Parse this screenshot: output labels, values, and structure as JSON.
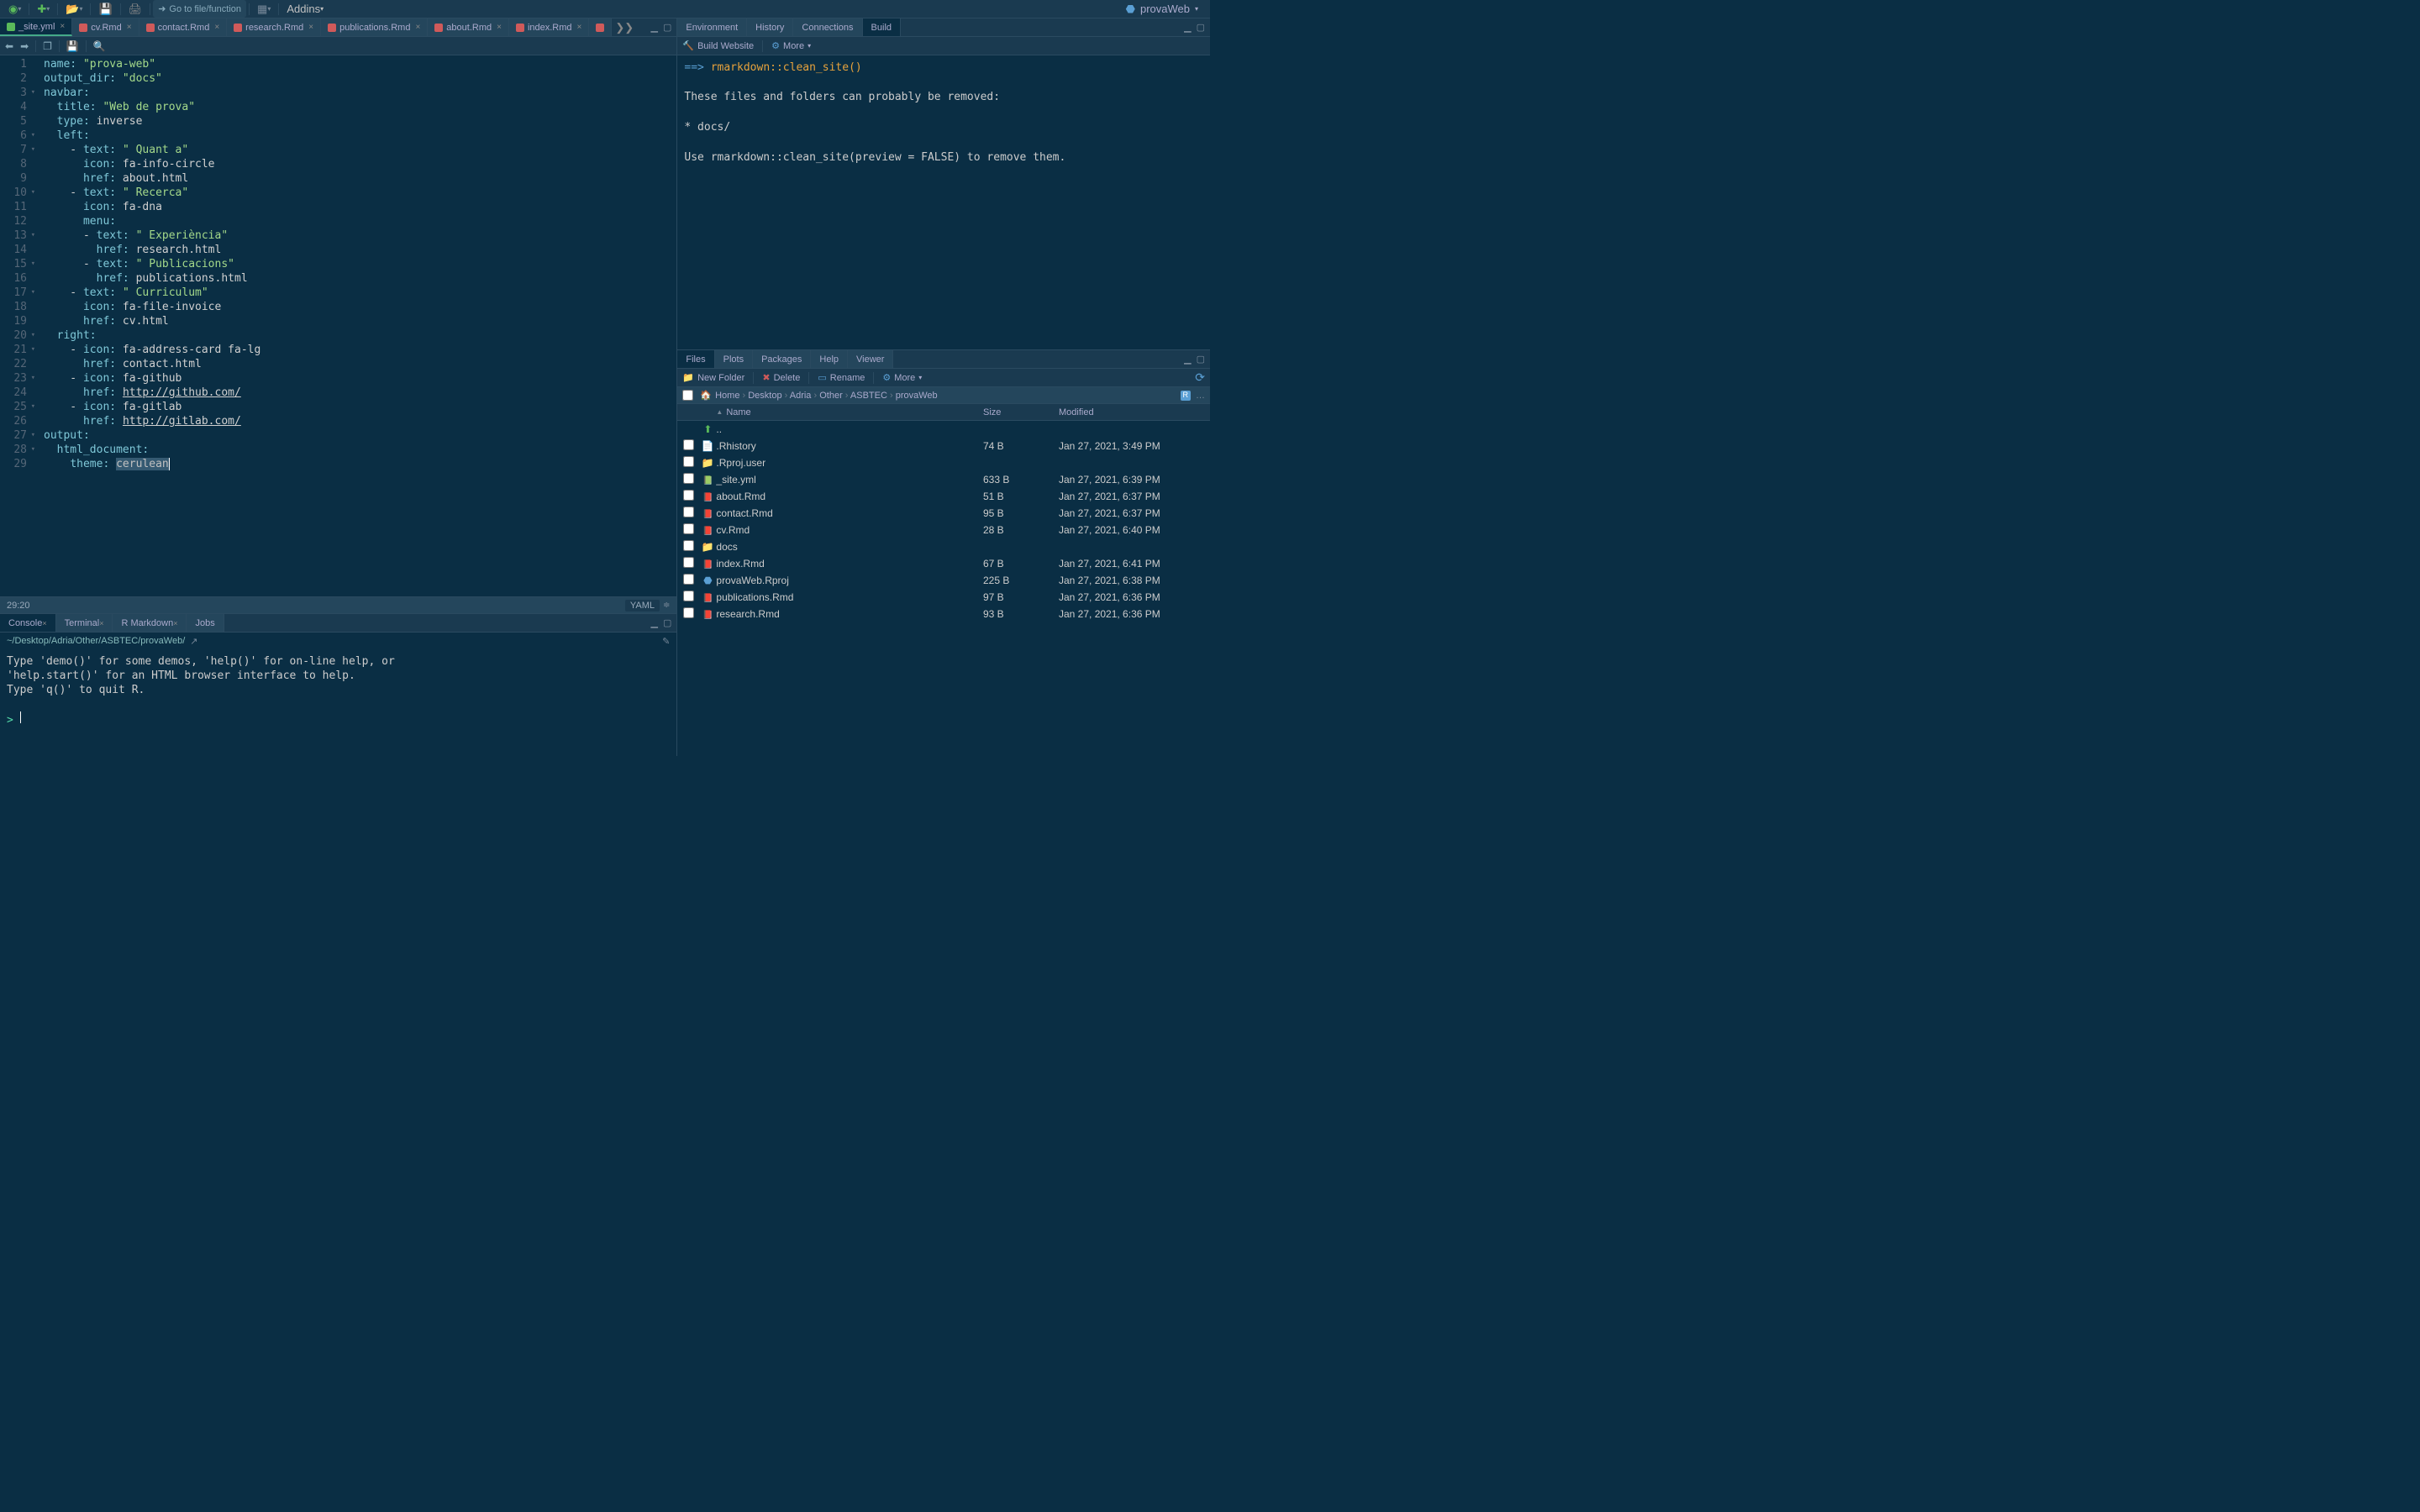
{
  "top": {
    "goto_placeholder": "Go to file/function",
    "addins_label": "Addins",
    "project_name": "provaWeb"
  },
  "source": {
    "tabs": [
      {
        "label": "_site.yml",
        "icon": "yml"
      },
      {
        "label": "cv.Rmd",
        "icon": "rmd"
      },
      {
        "label": "contact.Rmd",
        "icon": "rmd"
      },
      {
        "label": "research.Rmd",
        "icon": "rmd"
      },
      {
        "label": "publications.Rmd",
        "icon": "rmd"
      },
      {
        "label": "about.Rmd",
        "icon": "rmd"
      },
      {
        "label": "index.Rmd",
        "icon": "rmd"
      }
    ],
    "status": {
      "pos": "29:20",
      "lang": "YAML"
    },
    "code": [
      {
        "n": 1,
        "t": [
          [
            "k",
            "name:"
          ],
          [
            "v",
            " "
          ],
          [
            "s",
            "\"prova-web\""
          ]
        ]
      },
      {
        "n": 2,
        "t": [
          [
            "k",
            "output_dir:"
          ],
          [
            "v",
            " "
          ],
          [
            "s",
            "\"docs\""
          ]
        ]
      },
      {
        "n": 3,
        "f": true,
        "t": [
          [
            "k",
            "navbar:"
          ]
        ]
      },
      {
        "n": 4,
        "t": [
          [
            "v",
            "  "
          ],
          [
            "k",
            "title:"
          ],
          [
            "v",
            " "
          ],
          [
            "s",
            "\"Web de prova\""
          ]
        ]
      },
      {
        "n": 5,
        "t": [
          [
            "v",
            "  "
          ],
          [
            "k",
            "type:"
          ],
          [
            "v",
            " inverse"
          ]
        ]
      },
      {
        "n": 6,
        "f": true,
        "t": [
          [
            "v",
            "  "
          ],
          [
            "k",
            "left:"
          ]
        ]
      },
      {
        "n": 7,
        "f": true,
        "t": [
          [
            "v",
            "    - "
          ],
          [
            "k",
            "text:"
          ],
          [
            "v",
            " "
          ],
          [
            "s",
            "\" Quant a\""
          ]
        ]
      },
      {
        "n": 8,
        "t": [
          [
            "v",
            "      "
          ],
          [
            "k",
            "icon:"
          ],
          [
            "v",
            " fa-info-circle"
          ]
        ]
      },
      {
        "n": 9,
        "t": [
          [
            "v",
            "      "
          ],
          [
            "k",
            "href:"
          ],
          [
            "v",
            " about.html"
          ]
        ]
      },
      {
        "n": 10,
        "f": true,
        "t": [
          [
            "v",
            "    - "
          ],
          [
            "k",
            "text:"
          ],
          [
            "v",
            " "
          ],
          [
            "s",
            "\" Recerca\""
          ]
        ]
      },
      {
        "n": 11,
        "t": [
          [
            "v",
            "      "
          ],
          [
            "k",
            "icon:"
          ],
          [
            "v",
            " fa-dna"
          ]
        ]
      },
      {
        "n": 12,
        "t": [
          [
            "v",
            "      "
          ],
          [
            "k",
            "menu:"
          ]
        ]
      },
      {
        "n": 13,
        "f": true,
        "t": [
          [
            "v",
            "      - "
          ],
          [
            "k",
            "text:"
          ],
          [
            "v",
            " "
          ],
          [
            "s",
            "\" Experiència\""
          ]
        ]
      },
      {
        "n": 14,
        "t": [
          [
            "v",
            "        "
          ],
          [
            "k",
            "href:"
          ],
          [
            "v",
            " research.html"
          ]
        ]
      },
      {
        "n": 15,
        "f": true,
        "t": [
          [
            "v",
            "      - "
          ],
          [
            "k",
            "text:"
          ],
          [
            "v",
            " "
          ],
          [
            "s",
            "\" Publicacions\""
          ]
        ]
      },
      {
        "n": 16,
        "t": [
          [
            "v",
            "        "
          ],
          [
            "k",
            "href:"
          ],
          [
            "v",
            " publications.html"
          ]
        ]
      },
      {
        "n": 17,
        "f": true,
        "t": [
          [
            "v",
            "    - "
          ],
          [
            "k",
            "text:"
          ],
          [
            "v",
            " "
          ],
          [
            "s",
            "\" Curriculum\""
          ]
        ]
      },
      {
        "n": 18,
        "t": [
          [
            "v",
            "      "
          ],
          [
            "k",
            "icon:"
          ],
          [
            "v",
            " fa-file-invoice"
          ]
        ]
      },
      {
        "n": 19,
        "t": [
          [
            "v",
            "      "
          ],
          [
            "k",
            "href:"
          ],
          [
            "v",
            " cv.html"
          ]
        ]
      },
      {
        "n": 20,
        "f": true,
        "t": [
          [
            "v",
            "  "
          ],
          [
            "k",
            "right:"
          ]
        ]
      },
      {
        "n": 21,
        "f": true,
        "t": [
          [
            "v",
            "    - "
          ],
          [
            "k",
            "icon:"
          ],
          [
            "v",
            " fa-address-card fa-lg"
          ]
        ]
      },
      {
        "n": 22,
        "t": [
          [
            "v",
            "      "
          ],
          [
            "k",
            "href:"
          ],
          [
            "v",
            " contact.html"
          ]
        ]
      },
      {
        "n": 23,
        "f": true,
        "t": [
          [
            "v",
            "    - "
          ],
          [
            "k",
            "icon:"
          ],
          [
            "v",
            " fa-github"
          ]
        ]
      },
      {
        "n": 24,
        "t": [
          [
            "v",
            "      "
          ],
          [
            "k",
            "href:"
          ],
          [
            "v",
            " "
          ],
          [
            "u",
            "http://github.com/"
          ]
        ]
      },
      {
        "n": 25,
        "f": true,
        "t": [
          [
            "v",
            "    - "
          ],
          [
            "k",
            "icon:"
          ],
          [
            "v",
            " fa-gitlab"
          ]
        ]
      },
      {
        "n": 26,
        "t": [
          [
            "v",
            "      "
          ],
          [
            "k",
            "href:"
          ],
          [
            "v",
            " "
          ],
          [
            "u",
            "http://gitlab.com/"
          ]
        ]
      },
      {
        "n": 27,
        "f": true,
        "t": [
          [
            "k",
            "output:"
          ]
        ]
      },
      {
        "n": 28,
        "f": true,
        "t": [
          [
            "v",
            "  "
          ],
          [
            "k",
            "html_document:"
          ]
        ]
      },
      {
        "n": 29,
        "t": [
          [
            "v",
            "    "
          ],
          [
            "k",
            "theme:"
          ],
          [
            "v",
            " "
          ],
          [
            "sel",
            "cerulean"
          ]
        ],
        "cursor": true
      }
    ]
  },
  "console": {
    "tabs": [
      "Console",
      "Terminal",
      "R Markdown",
      "Jobs"
    ],
    "path": "~/Desktop/Adria/Other/ASBTEC/provaWeb/",
    "lines": [
      "Type 'demo()' for some demos, 'help()' for on-line help, or",
      "'help.start()' for an HTML browser interface to help.",
      "Type 'q()' to quit R.",
      ""
    ],
    "prompt": ">"
  },
  "build": {
    "tabs": [
      "Environment",
      "History",
      "Connections",
      "Build"
    ],
    "toolbar": {
      "build_site": "Build Website",
      "more": "More"
    },
    "output": {
      "cmd": "rmarkdown::clean_site()",
      "lines": [
        "These files and folders can probably be removed:",
        "",
        "* docs/",
        "",
        "Use rmarkdown::clean_site(preview = FALSE) to remove them."
      ]
    }
  },
  "files": {
    "tabs": [
      "Files",
      "Plots",
      "Packages",
      "Help",
      "Viewer"
    ],
    "toolbar": {
      "new_folder": "New Folder",
      "delete": "Delete",
      "rename": "Rename",
      "more": "More"
    },
    "breadcrumb": [
      "Home",
      "Desktop",
      "Adria",
      "Other",
      "ASBTEC",
      "provaWeb"
    ],
    "headers": {
      "name": "Name",
      "size": "Size",
      "modified": "Modified"
    },
    "up": "..",
    "items": [
      {
        "icon": "txt",
        "name": ".Rhistory",
        "size": "74 B",
        "mod": "Jan 27, 2021, 3:49 PM"
      },
      {
        "icon": "folder",
        "name": ".Rproj.user",
        "size": "",
        "mod": ""
      },
      {
        "icon": "yml",
        "name": "_site.yml",
        "size": "633 B",
        "mod": "Jan 27, 2021, 6:39 PM"
      },
      {
        "icon": "rmd",
        "name": "about.Rmd",
        "size": "51 B",
        "mod": "Jan 27, 2021, 6:37 PM"
      },
      {
        "icon": "rmd",
        "name": "contact.Rmd",
        "size": "95 B",
        "mod": "Jan 27, 2021, 6:37 PM"
      },
      {
        "icon": "rmd",
        "name": "cv.Rmd",
        "size": "28 B",
        "mod": "Jan 27, 2021, 6:40 PM"
      },
      {
        "icon": "folder",
        "name": "docs",
        "size": "",
        "mod": ""
      },
      {
        "icon": "rmd",
        "name": "index.Rmd",
        "size": "67 B",
        "mod": "Jan 27, 2021, 6:41 PM"
      },
      {
        "icon": "rproj",
        "name": "provaWeb.Rproj",
        "size": "225 B",
        "mod": "Jan 27, 2021, 6:38 PM"
      },
      {
        "icon": "rmd",
        "name": "publications.Rmd",
        "size": "97 B",
        "mod": "Jan 27, 2021, 6:36 PM"
      },
      {
        "icon": "rmd",
        "name": "research.Rmd",
        "size": "93 B",
        "mod": "Jan 27, 2021, 6:36 PM"
      }
    ]
  }
}
